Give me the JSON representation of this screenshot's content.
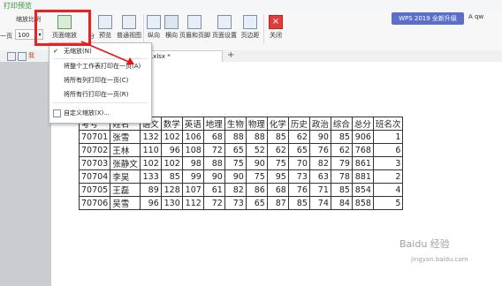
{
  "window": {
    "title": "打印预览"
  },
  "ribbon": {
    "zoom_ratio_label": "缩放比例",
    "pages_label": "一页",
    "zoom_value": "100",
    "buttons": [
      {
        "label": "页面缩放"
      },
      {
        "label": "预览"
      },
      {
        "label": "普通视图"
      },
      {
        "label": "纵向"
      },
      {
        "label": "横向"
      },
      {
        "label": "页眉和页脚"
      },
      {
        "label": "页面设置"
      },
      {
        "label": "页边距"
      },
      {
        "label": "关闭"
      }
    ],
    "partial_char": "分"
  },
  "promo": {
    "text": "WPS 2019 全新升级"
  },
  "user": {
    "initial": "A",
    "name": "qw"
  },
  "toolbar2": {
    "doc_tab": "l.xlsx *",
    "add_tab": "+",
    "partial_left": "我"
  },
  "dropdown": {
    "items": [
      {
        "label": "无缩放(N)",
        "checked": true
      },
      {
        "label": "将整个工作表打印在一页(A)",
        "checked": false
      },
      {
        "label": "将所有列打印在一页(C)",
        "checked": false
      },
      {
        "label": "将所有行打印在一页(R)",
        "checked": false
      },
      {
        "label": "自定义缩放(X)...",
        "checked": false
      }
    ],
    "check_mark": "✔"
  },
  "sheet": {
    "headers": [
      "考号",
      "姓名",
      "语文",
      "数学",
      "英语",
      "地理",
      "生物",
      "物理",
      "化学",
      "历史",
      "政治",
      "综合",
      "总分",
      "班名次"
    ],
    "rows": [
      [
        "70701",
        "张雪",
        "132",
        "102",
        "106",
        "68",
        "88",
        "88",
        "85",
        "62",
        "90",
        "85",
        "906",
        "1"
      ],
      [
        "70702",
        "王林",
        "110",
        "96",
        "108",
        "72",
        "65",
        "52",
        "62",
        "65",
        "76",
        "62",
        "768",
        "6"
      ],
      [
        "70703",
        "张静文",
        "102",
        "102",
        "98",
        "88",
        "75",
        "90",
        "75",
        "70",
        "82",
        "79",
        "861",
        "3"
      ],
      [
        "70704",
        "李昊",
        "133",
        "85",
        "99",
        "90",
        "90",
        "75",
        "95",
        "73",
        "63",
        "78",
        "881",
        "2"
      ],
      [
        "70705",
        "王磊",
        "89",
        "128",
        "107",
        "61",
        "82",
        "86",
        "68",
        "76",
        "71",
        "85",
        "854",
        "4"
      ],
      [
        "70706",
        "吴雪",
        "96",
        "130",
        "112",
        "72",
        "73",
        "65",
        "87",
        "85",
        "74",
        "84",
        "858",
        "5"
      ]
    ]
  },
  "watermark": {
    "brand": "Baidu 经验",
    "url": "jingyan.baidu.com"
  }
}
